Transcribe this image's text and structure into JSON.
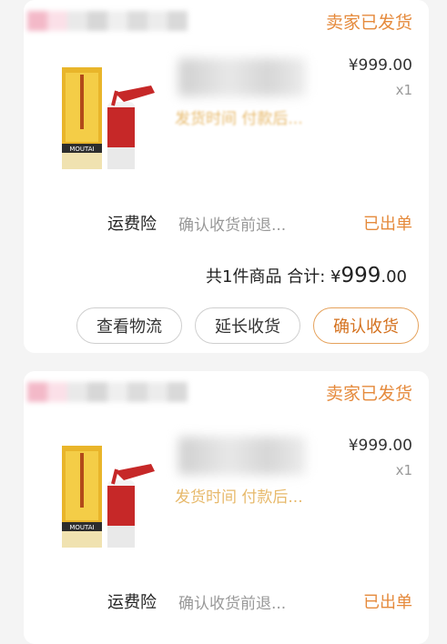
{
  "orders": [
    {
      "status": "卖家已发货",
      "price": "¥999.00",
      "quantity": "x1",
      "ship_note": "发货时间 付款后...",
      "insurance": {
        "label": "运费险",
        "desc": "确认收货前退...",
        "status": "已出单"
      },
      "total": {
        "prefix": "共1件商品 合计: ¥",
        "amount_main": "999",
        "amount_cents": ".00"
      },
      "buttons": {
        "logistics": "查看物流",
        "extend": "延长收货",
        "confirm": "确认收货"
      }
    },
    {
      "status": "卖家已发货",
      "price": "¥999.00",
      "quantity": "x1",
      "ship_note": "发货时间 付款后...",
      "insurance": {
        "label": "运费险",
        "desc": "确认收货前退...",
        "status": "已出单"
      }
    }
  ],
  "product_brand_text": "MOUTAI",
  "colors": {
    "accent": "#e58a3c",
    "note": "#e7b96b",
    "muted": "#999999"
  }
}
